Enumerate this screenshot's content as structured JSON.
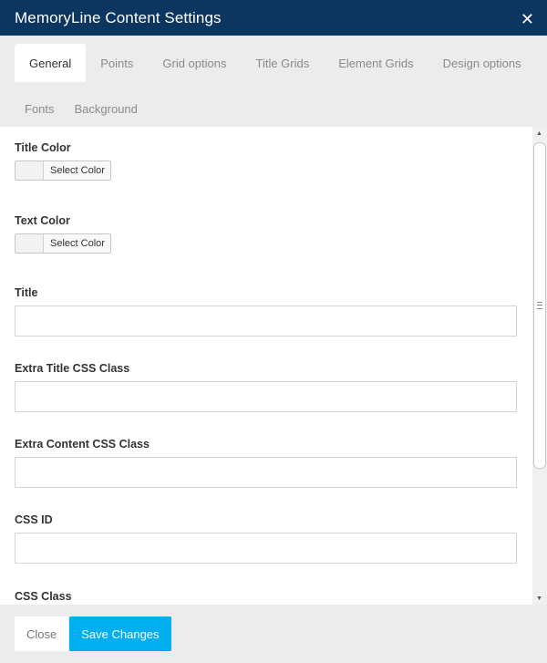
{
  "header": {
    "title": "MemoryLine Content Settings",
    "close_icon": "✕"
  },
  "tabs_row1": [
    "General",
    "Points",
    "Grid options",
    "Title Grids",
    "Element Grids",
    "Design options"
  ],
  "tabs_row2": [
    "Fonts",
    "Background"
  ],
  "active_tab": "General",
  "fields": {
    "title_color": {
      "label": "Title Color",
      "button": "Select Color"
    },
    "text_color": {
      "label": "Text Color",
      "button": "Select Color"
    },
    "title": {
      "label": "Title",
      "value": ""
    },
    "extra_title_css": {
      "label": "Extra Title CSS Class",
      "value": ""
    },
    "extra_content_css": {
      "label": "Extra Content CSS Class",
      "value": ""
    },
    "css_id": {
      "label": "CSS ID",
      "value": ""
    },
    "css_class": {
      "label": "CSS Class",
      "value": ""
    }
  },
  "footer": {
    "close_label": "Close",
    "save_label": "Save Changes"
  },
  "colors": {
    "header_bg": "#0c3660",
    "accent": "#00aff0",
    "tabs_bg": "#ececec"
  }
}
